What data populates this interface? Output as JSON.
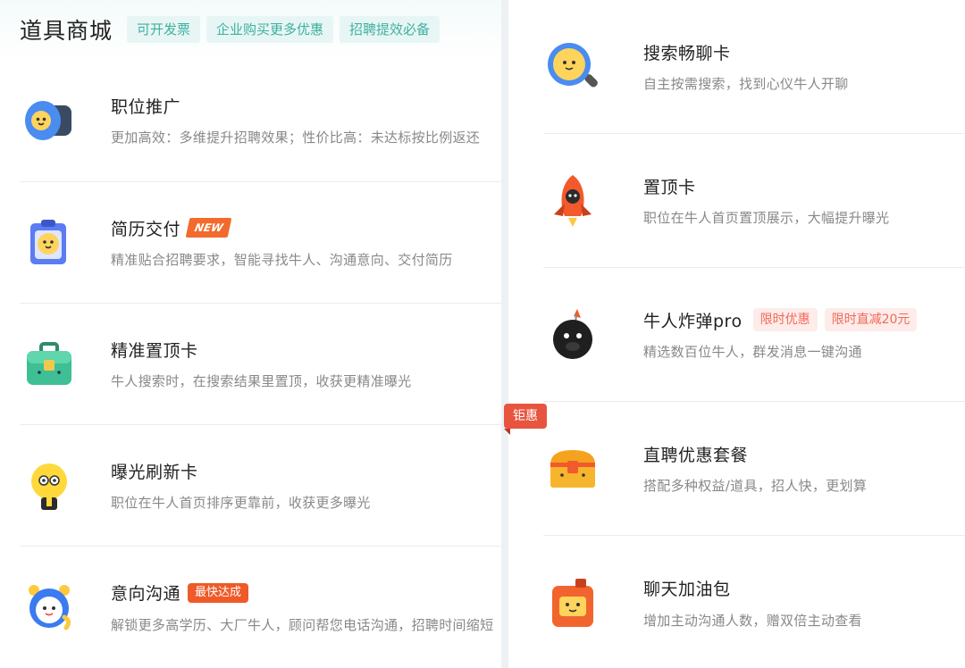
{
  "header": {
    "title": "道具商城",
    "chips": [
      "可开发票",
      "企业购买更多优惠",
      "招聘提效必备"
    ]
  },
  "left_items": [
    {
      "name": "职位推广",
      "desc": "更加高效：多维提升招聘效果；性价比高：未达标按比例返还",
      "icon": "megaphone-icon"
    },
    {
      "name": "简历交付",
      "badge": "NEW",
      "desc": "精准贴合招聘要求，智能寻找牛人、沟通意向、交付简历",
      "icon": "clipboard-icon"
    },
    {
      "name": "精准置顶卡",
      "desc": "牛人搜索时，在搜索结果里置顶，收获更精准曝光",
      "icon": "briefcase-icon"
    },
    {
      "name": "曝光刷新卡",
      "desc": "职位在牛人首页排序更靠前，收获更多曝光",
      "icon": "lightbulb-icon"
    },
    {
      "name": "意向沟通",
      "badge": "最快达成",
      "desc": "解锁更多高学历、大厂牛人，顾问帮您电话沟通，招聘时间缩短",
      "icon": "phone-robot-icon"
    }
  ],
  "right_items": [
    {
      "name": "搜索畅聊卡",
      "desc": "自主按需搜索，找到心仪牛人开聊",
      "icon": "magnifier-icon"
    },
    {
      "name": "置顶卡",
      "desc": "职位在牛人首页置顶展示，大幅提升曝光",
      "icon": "rocket-icon"
    },
    {
      "name": "牛人炸弹pro",
      "badges": [
        "限时优惠",
        "限时直减20元"
      ],
      "desc": "精选数百位牛人，群发消息一键沟通",
      "icon": "bomb-icon"
    },
    {
      "name": "直聘优惠套餐",
      "desc": "搭配多种权益/道具，招人快，更划算",
      "icon": "treasure-chest-icon"
    },
    {
      "name": "聊天加油包",
      "desc": "增加主动沟通人数，赠双倍主动查看",
      "icon": "fuel-can-icon"
    }
  ],
  "side_tag": "钜惠",
  "colors": {
    "accent_teal": "#3fb0a1",
    "chip_bg": "#e7f6f4",
    "badge_orange": "#ee5a28",
    "badge_pale_bg": "#fdecea",
    "badge_pale_text": "#f06a58"
  }
}
